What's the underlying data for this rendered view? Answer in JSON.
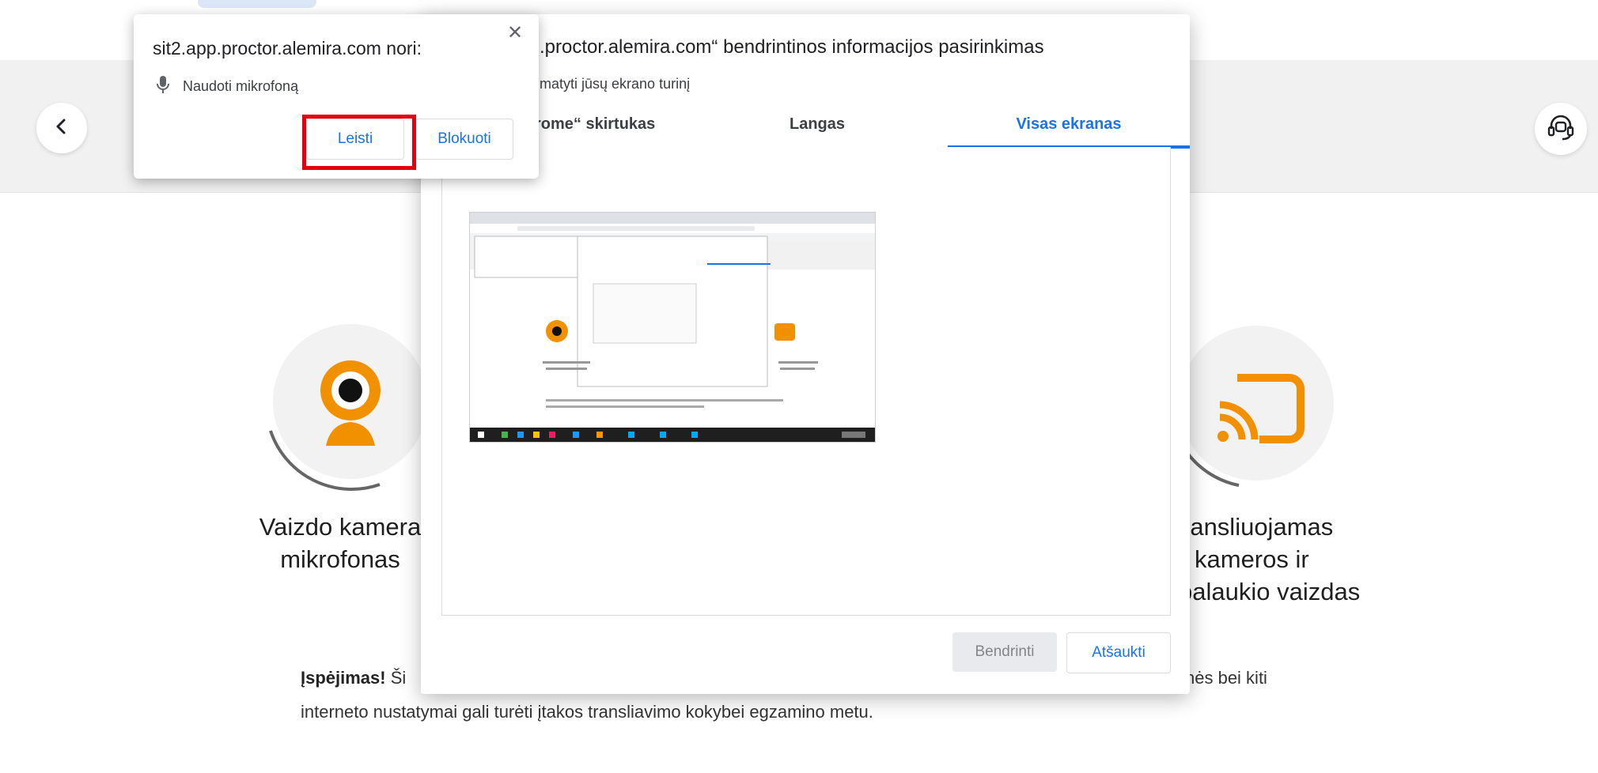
{
  "header": {
    "back_icon": "chevron-left-icon",
    "support_icon": "headset-support-icon"
  },
  "features": {
    "camera": {
      "label_line1": "Vaizdo kamera",
      "label_line2": "mikrofonas",
      "icon": "webcam-icon",
      "color": "#f29100"
    },
    "stream": {
      "label_line1": "ransliuojamas",
      "label_line2": "kameros ir",
      "label_line3": "palaukio vaizdas",
      "icon": "cast-icon",
      "color": "#f29100"
    }
  },
  "warning": {
    "strong": "Įspėjimas!",
    "line1_start": " Ši",
    "line1_end": "nės bei kiti",
    "line2": "interneto nustatymai gali turėti įtakos transliavimo kokybei egzamino metu."
  },
  "share_dialog": {
    "title": ".proctor.alemira.com“ bendrintinos informacijos pasirinkimas",
    "subtitle": "matyti jūsų ekrano turinį",
    "tabs": [
      {
        "label": "rome“ skirtukas",
        "active": false
      },
      {
        "label": "Langas",
        "active": false
      },
      {
        "label": "Visas ekranas",
        "active": true
      }
    ],
    "share_button": "Bendrinti",
    "cancel_button": "Atšaukti"
  },
  "permission_popup": {
    "title": "sit2.app.proctor.alemira.com nori:",
    "permission_label": "Naudoti mikrofoną",
    "permission_icon": "microphone-icon",
    "allow_button": "Leisti",
    "block_button": "Blokuoti",
    "close_icon": "close-icon"
  },
  "colors": {
    "accent": "#1a73e8",
    "brand_orange": "#f29100",
    "highlight_red": "#e3000f"
  }
}
